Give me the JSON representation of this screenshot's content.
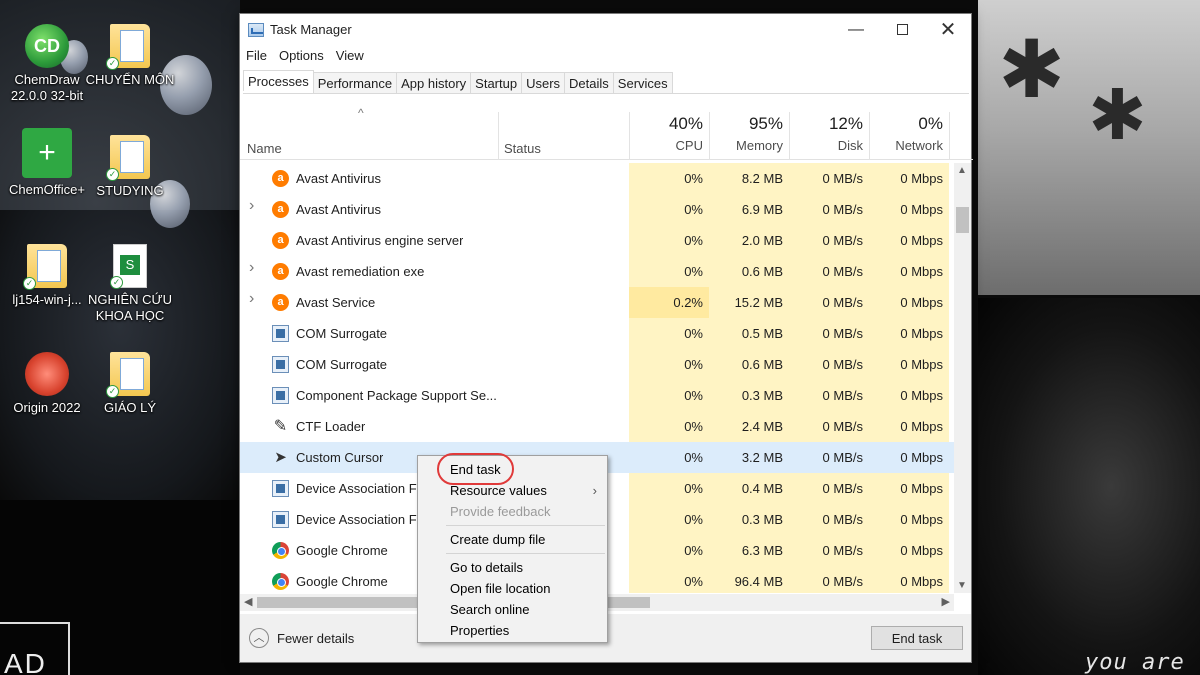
{
  "desktop": {
    "icons": [
      {
        "label": "ChemDraw 22.0.0 32-bit",
        "glyph": "CD"
      },
      {
        "label": "CHUYỂN MÔN"
      },
      {
        "label": "ChemOffice+",
        "glyph": "+"
      },
      {
        "label": "STUDYING"
      },
      {
        "label": "lj154-win-j..."
      },
      {
        "label": "NGHIÊN CỨU KHOA HỌC"
      },
      {
        "label": "Origin 2022"
      },
      {
        "label": "GIÁO LÝ"
      }
    ],
    "wallpaper_text_right": "you are r",
    "wallpaper_text_left": "AD"
  },
  "window": {
    "title": "Task Manager",
    "controls": {
      "minimize": "—",
      "close": "✕"
    },
    "menu": [
      "File",
      "Options",
      "View"
    ],
    "tabs": [
      "Processes",
      "Performance",
      "App history",
      "Startup",
      "Users",
      "Details",
      "Services"
    ],
    "active_tab": "Processes"
  },
  "table": {
    "sort_indicator": "^",
    "columns": {
      "name": "Name",
      "status": "Status",
      "cpu": {
        "pct": "40%",
        "label": "CPU"
      },
      "memory": {
        "pct": "95%",
        "label": "Memory"
      },
      "disk": {
        "pct": "12%",
        "label": "Disk"
      },
      "network": {
        "pct": "0%",
        "label": "Network"
      }
    },
    "rows": [
      {
        "name": "Avast Antivirus",
        "icon": "avast-icon",
        "expandable": false,
        "cpu": "0%",
        "memory": "8.2 MB",
        "disk": "0 MB/s",
        "network": "0 Mbps"
      },
      {
        "name": "Avast Antivirus",
        "icon": "avast-icon",
        "expandable": true,
        "cpu": "0%",
        "memory": "6.9 MB",
        "disk": "0 MB/s",
        "network": "0 Mbps"
      },
      {
        "name": "Avast Antivirus engine server",
        "icon": "avast-icon",
        "expandable": false,
        "cpu": "0%",
        "memory": "2.0 MB",
        "disk": "0 MB/s",
        "network": "0 Mbps"
      },
      {
        "name": "Avast remediation exe",
        "icon": "avast-icon",
        "expandable": true,
        "cpu": "0%",
        "memory": "0.6 MB",
        "disk": "0 MB/s",
        "network": "0 Mbps"
      },
      {
        "name": "Avast Service",
        "icon": "avast-icon",
        "expandable": true,
        "cpu": "0.2%",
        "memory": "15.2 MB",
        "disk": "0 MB/s",
        "network": "0 Mbps"
      },
      {
        "name": "COM Surrogate",
        "icon": "system-process-icon",
        "expandable": false,
        "cpu": "0%",
        "memory": "0.5 MB",
        "disk": "0 MB/s",
        "network": "0 Mbps"
      },
      {
        "name": "COM Surrogate",
        "icon": "system-process-icon",
        "expandable": false,
        "cpu": "0%",
        "memory": "0.6 MB",
        "disk": "0 MB/s",
        "network": "0 Mbps"
      },
      {
        "name": "Component Package Support Se...",
        "icon": "system-process-icon",
        "expandable": false,
        "cpu": "0%",
        "memory": "0.3 MB",
        "disk": "0 MB/s",
        "network": "0 Mbps"
      },
      {
        "name": "CTF Loader",
        "icon": "ctf-loader-icon",
        "expandable": false,
        "cpu": "0%",
        "memory": "2.4 MB",
        "disk": "0 MB/s",
        "network": "0 Mbps"
      },
      {
        "name": "Custom Cursor",
        "icon": "cursor-icon",
        "expandable": false,
        "selected": true,
        "cpu": "0%",
        "memory": "3.2 MB",
        "disk": "0 MB/s",
        "network": "0 Mbps"
      },
      {
        "name": "Device Association Fr",
        "icon": "system-process-icon",
        "expandable": false,
        "cpu": "0%",
        "memory": "0.4 MB",
        "disk": "0 MB/s",
        "network": "0 Mbps"
      },
      {
        "name": "Device Association Fr",
        "icon": "system-process-icon",
        "expandable": false,
        "cpu": "0%",
        "memory": "0.3 MB",
        "disk": "0 MB/s",
        "network": "0 Mbps"
      },
      {
        "name": "Google Chrome",
        "icon": "chrome-icon",
        "expandable": false,
        "cpu": "0%",
        "memory": "6.3 MB",
        "disk": "0 MB/s",
        "network": "0 Mbps"
      },
      {
        "name": "Google Chrome",
        "icon": "chrome-icon",
        "expandable": false,
        "cpu": "0%",
        "memory": "96.4 MB",
        "disk": "0 MB/s",
        "network": "0 Mbps"
      }
    ]
  },
  "context_menu": {
    "items": [
      {
        "label": "End task",
        "highlighted": true
      },
      {
        "label": "Resource values",
        "submenu": true
      },
      {
        "label": "Provide feedback",
        "disabled": true
      },
      {
        "separator": true
      },
      {
        "label": "Create dump file"
      },
      {
        "separator": true
      },
      {
        "label": "Go to details"
      },
      {
        "label": "Open file location"
      },
      {
        "label": "Search online"
      },
      {
        "label": "Properties"
      }
    ]
  },
  "footer": {
    "fewer_details": "Fewer details",
    "end_task": "End task"
  },
  "colors": {
    "heat_light": "#fff4c4",
    "heat_medium": "#ffeaa0",
    "selected_row": "#dcecfb",
    "highlight_ring": "#e03a3a",
    "avast_orange": "#ff7c00"
  }
}
